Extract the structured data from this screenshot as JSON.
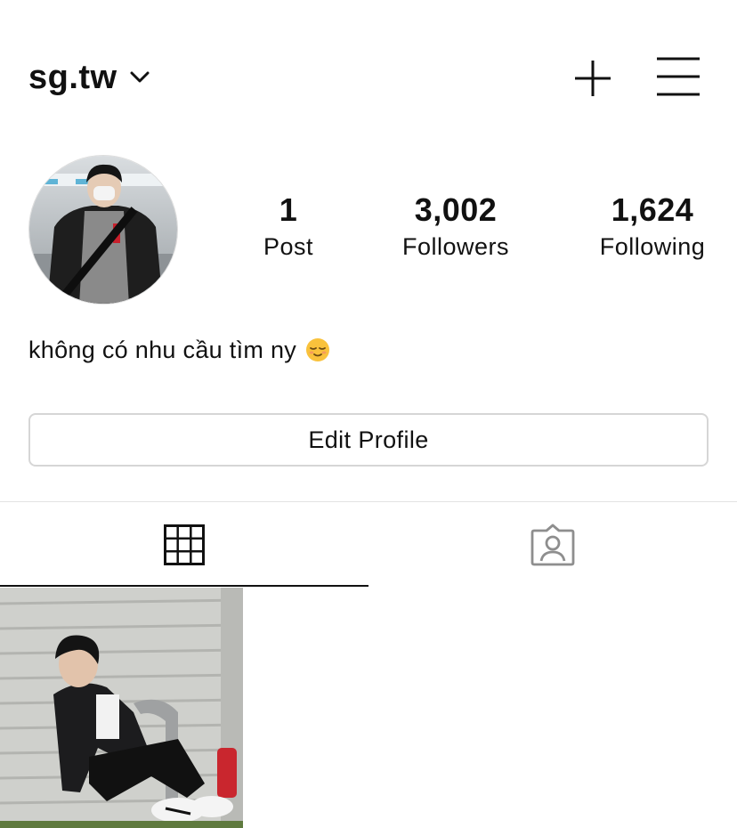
{
  "header": {
    "username": "sg.tw",
    "icons": [
      "chevron-down-icon",
      "plus-icon",
      "hamburger-menu-icon"
    ]
  },
  "stats": {
    "posts": {
      "count": "1",
      "label": "Post"
    },
    "followers": {
      "count": "3,002",
      "label": "Followers"
    },
    "following": {
      "count": "1,624",
      "label": "Following"
    }
  },
  "bio": {
    "text": "không có nhu cầu tìm ny",
    "emoji": "relieved-face-emoji"
  },
  "actions": {
    "edit_profile_label": "Edit Profile"
  },
  "tabs": [
    {
      "name": "grid",
      "icon": "grid-icon",
      "active": true
    },
    {
      "name": "tagged",
      "icon": "tagged-person-icon",
      "active": false
    }
  ],
  "colors": {
    "text": "#111111",
    "border": "#d6d6d6",
    "divider": "#e3e3e3",
    "inactive_icon": "#8e8e8e"
  }
}
